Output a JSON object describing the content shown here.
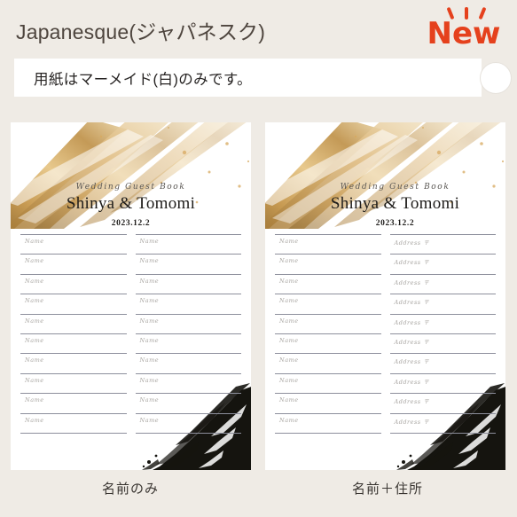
{
  "header": {
    "title": "Japanesque(ジャパネスク)",
    "badge": {
      "label": "New",
      "color": "#e5411d",
      "rays_icon": "sparkle-rays-icon"
    }
  },
  "notice": {
    "text": "用紙はマーメイド(白)のみです。",
    "circle_icon": "circle-badge-icon"
  },
  "cards": [
    {
      "id": "name-only",
      "script_title": "Wedding Guest Book",
      "names": "Shinya & Tomomi",
      "date": "2023.12.2",
      "columns": [
        "Name",
        "Name"
      ],
      "row_count": 10,
      "caption": "名前のみ",
      "gold_art": "gold-brush-stroke-art",
      "ink_art": "black-ink-brush-art"
    },
    {
      "id": "name-plus-address",
      "script_title": "Wedding Guest Book",
      "names": "Shinya & Tomomi",
      "date": "2023.12.2",
      "columns": [
        "Name",
        "Address 〒"
      ],
      "row_count": 10,
      "caption": "名前＋住所",
      "gold_art": "gold-brush-stroke-art",
      "ink_art": "black-ink-brush-art"
    }
  ],
  "colors": {
    "background": "#efebe5",
    "card": "#ffffff",
    "accent": "#e5411d",
    "rule": "#8d8f9c",
    "gold": "#c79a52",
    "ink": "#1a1a1a",
    "title_text": "#4e453e"
  }
}
